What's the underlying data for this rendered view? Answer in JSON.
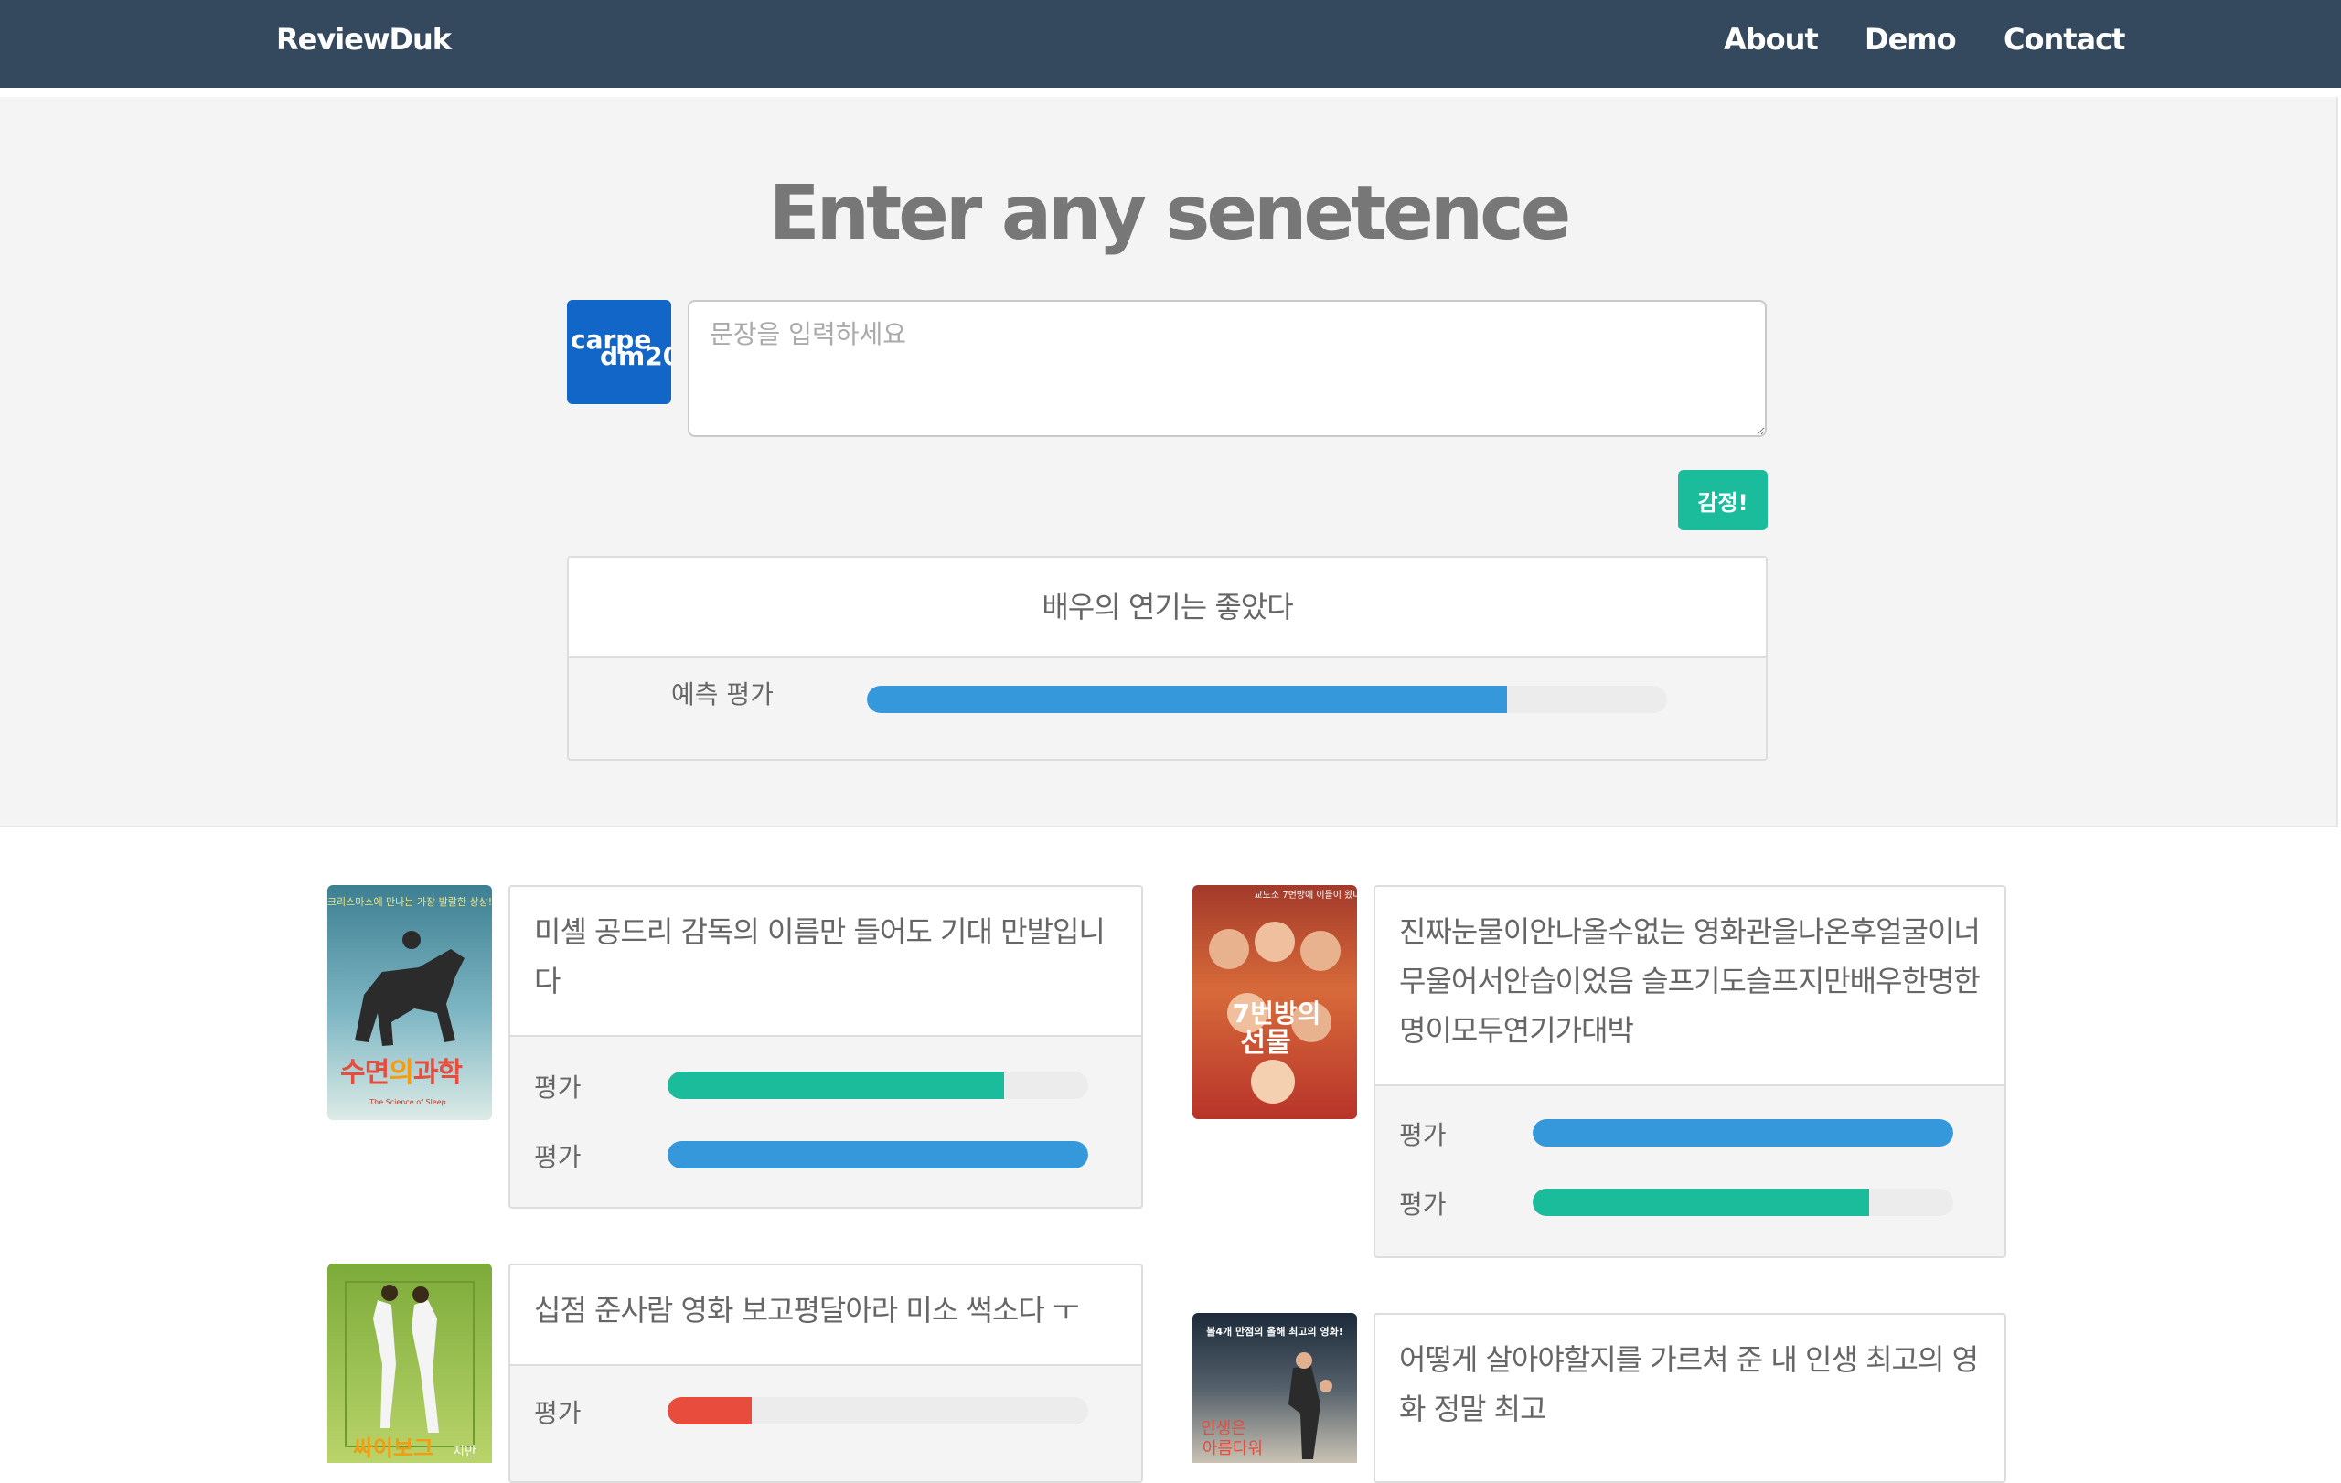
{
  "nav": {
    "brand": "ReviewDuk",
    "links": [
      "About",
      "Demo",
      "Contact"
    ]
  },
  "hero": {
    "title": "Enter any senetence",
    "logo_line1": "carpe",
    "logo_line2": "dm20",
    "input_placeholder": "문장을 입력하세요",
    "input_value": "",
    "analyze_button": "감정!",
    "result": {
      "sentence": "배우의 연기는 좋았다",
      "label": "예측 평가",
      "score": 0.8,
      "color": "#3498db"
    }
  },
  "reviews": [
    {
      "text": "미셸 공드리 감독의 이름만 들어도 기대 만발입니다",
      "poster": {
        "tagline": "크리스마스에 만나는 가장 발랄한 상상!",
        "title1": "수면",
        "title2": "의",
        "title3": "과학",
        "sub": "The Science of Sleep"
      },
      "ratings": [
        {
          "label": "평가",
          "score": 0.8,
          "color": "#1abc9c"
        },
        {
          "label": "평가",
          "score": 1.0,
          "color": "#3498db"
        }
      ]
    },
    {
      "text": "진짜눈물이안나올수없는 영화관을나온후얼굴이너무울어서안습이었음 슬프기도슬프지만배우한명한명이모두연기가대박",
      "poster": {
        "tagline": "교도소 7번방에 이들이 왔다!",
        "title1": "7번방의",
        "title2": "선물"
      },
      "ratings": [
        {
          "label": "평가",
          "score": 1.0,
          "color": "#3498db"
        },
        {
          "label": "평가",
          "score": 0.8,
          "color": "#1abc9c"
        }
      ]
    },
    {
      "text": "십점 준사람 영화 보고평달아라 미소 썩소다 ㅜ",
      "poster": {
        "title1": "싸이보그",
        "title2": "지만"
      },
      "ratings": [
        {
          "label": "평가",
          "score": 0.2,
          "color": "#e74c3c"
        }
      ]
    },
    {
      "text": "어떻게 살아야할지를 가르쳐 준 내 인생 최고의 영화 정말 최고",
      "poster": {
        "tagline": "볼4개 만점의 올해 최고의 영화!",
        "title1": "인생은",
        "title2": "아름다워"
      },
      "ratings": []
    }
  ]
}
